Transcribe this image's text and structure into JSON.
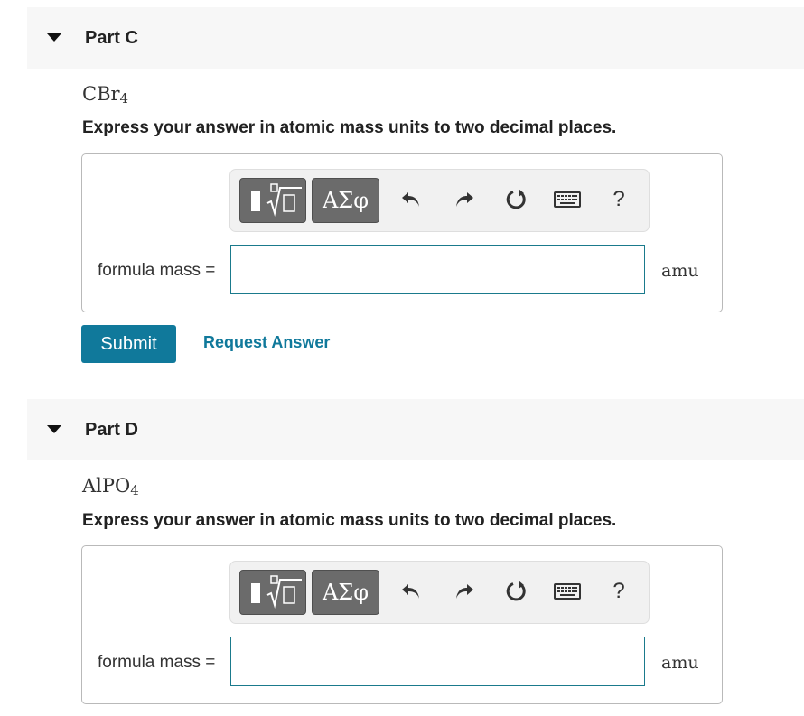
{
  "parts": [
    {
      "title": "Part C",
      "formula_main": "CBr",
      "formula_sub": "4",
      "instruction": "Express your answer in atomic mass units to two decimal places.",
      "input_label": "formula mass =",
      "input_value": "",
      "unit": "amu",
      "toolbar": {
        "greek_label": "ΑΣφ",
        "help_label": "?"
      }
    },
    {
      "title": "Part D",
      "formula_main": "AlPO",
      "formula_sub": "4",
      "instruction": "Express your answer in atomic mass units to two decimal places.",
      "input_label": "formula mass =",
      "input_value": "",
      "unit": "amu",
      "toolbar": {
        "greek_label": "ΑΣφ",
        "help_label": "?"
      }
    }
  ],
  "actions": {
    "submit_label": "Submit",
    "request_label": "Request Answer"
  },
  "colors": {
    "accent": "#10799b",
    "header_bg": "#f7f7f7",
    "button_gray": "#6b6b6b"
  },
  "icons": [
    "collapse-caret-icon",
    "templates-icon",
    "undo-icon",
    "redo-icon",
    "reset-icon",
    "keyboard-icon",
    "help-icon"
  ]
}
